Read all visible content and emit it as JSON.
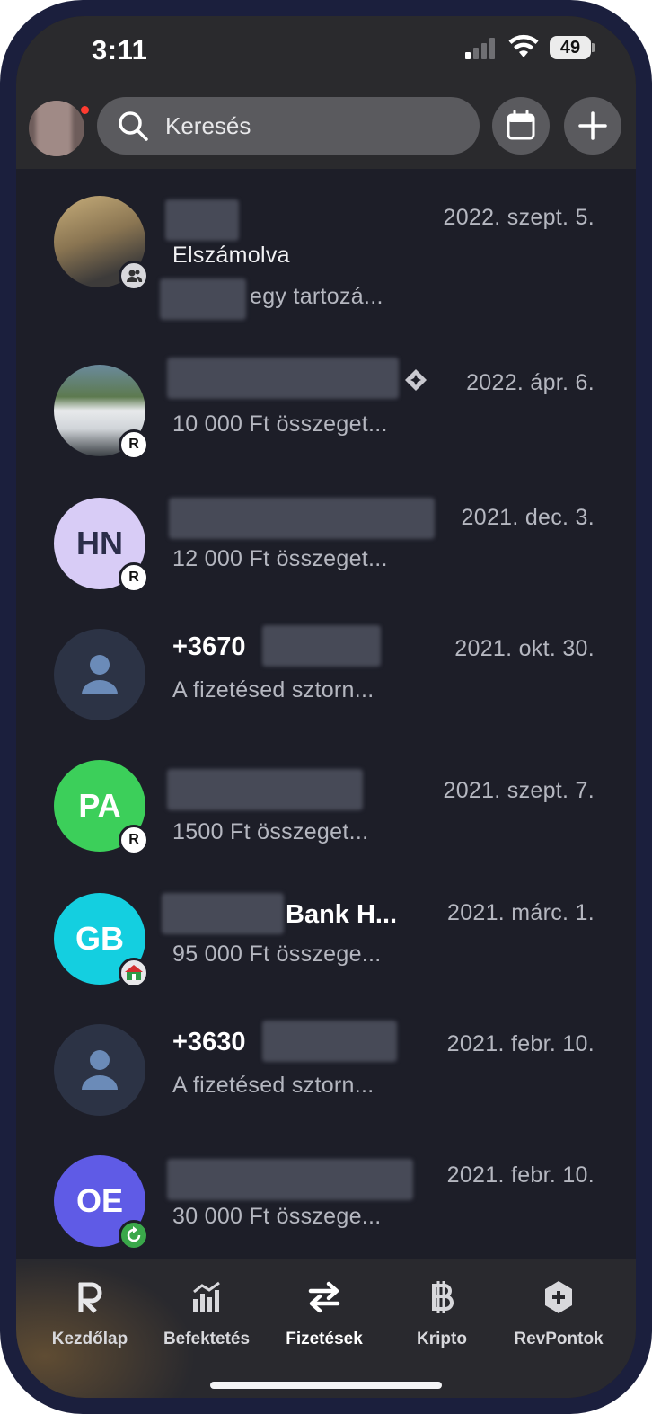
{
  "status_bar": {
    "time": "3:11",
    "battery": "49"
  },
  "header": {
    "search_placeholder": "Keresés"
  },
  "transactions": [
    {
      "name": "",
      "subtitle_top": "Elszámolva",
      "subtitle": "egy tartozá...",
      "date": "2022. szept. 5.",
      "avatar_initials": "",
      "badge": "group-icon"
    },
    {
      "name": "",
      "subtitle": "10 000 Ft összeget...",
      "date": "2022. ápr. 6.",
      "avatar_initials": "",
      "badge": "revolut-icon"
    },
    {
      "name": "",
      "subtitle": "12 000 Ft összeget...",
      "date": "2021. dec. 3.",
      "avatar_initials": "HN",
      "badge": "revolut-icon"
    },
    {
      "name": "+3670",
      "subtitle": "A fizetésed sztorn...",
      "date": "2021. okt. 30.",
      "avatar_initials": "",
      "badge": ""
    },
    {
      "name": "",
      "subtitle": "1500 Ft összeget...",
      "date": "2021. szept. 7.",
      "avatar_initials": "PA",
      "badge": "revolut-icon"
    },
    {
      "name": "Bank H...",
      "subtitle": "95 000 Ft összege...",
      "date": "2021. márc. 1.",
      "avatar_initials": "GB",
      "badge": "bank-icon"
    },
    {
      "name": "+3630",
      "subtitle": "A fizetésed sztorn...",
      "date": "2021. febr. 10.",
      "avatar_initials": "",
      "badge": ""
    },
    {
      "name": "",
      "subtitle": "30 000 Ft összege...",
      "date": "2021. febr. 10.",
      "avatar_initials": "OE",
      "badge": "refresh-icon"
    }
  ],
  "tabs": [
    {
      "label": "Kezdőlap",
      "icon": "revolut-logo-icon"
    },
    {
      "label": "Befektetés",
      "icon": "chart-bars-icon"
    },
    {
      "label": "Fizetések",
      "icon": "transfer-arrows-icon",
      "active": true
    },
    {
      "label": "Kripto",
      "icon": "bitcoin-icon"
    },
    {
      "label": "RevPontok",
      "icon": "hexagon-plus-icon"
    }
  ],
  "colors": {
    "HN": "#d8ccf6",
    "PA": "#3ccf5a",
    "GB": "#14cfe0",
    "OE": "#5f5be6",
    "person": "#2c3345"
  }
}
